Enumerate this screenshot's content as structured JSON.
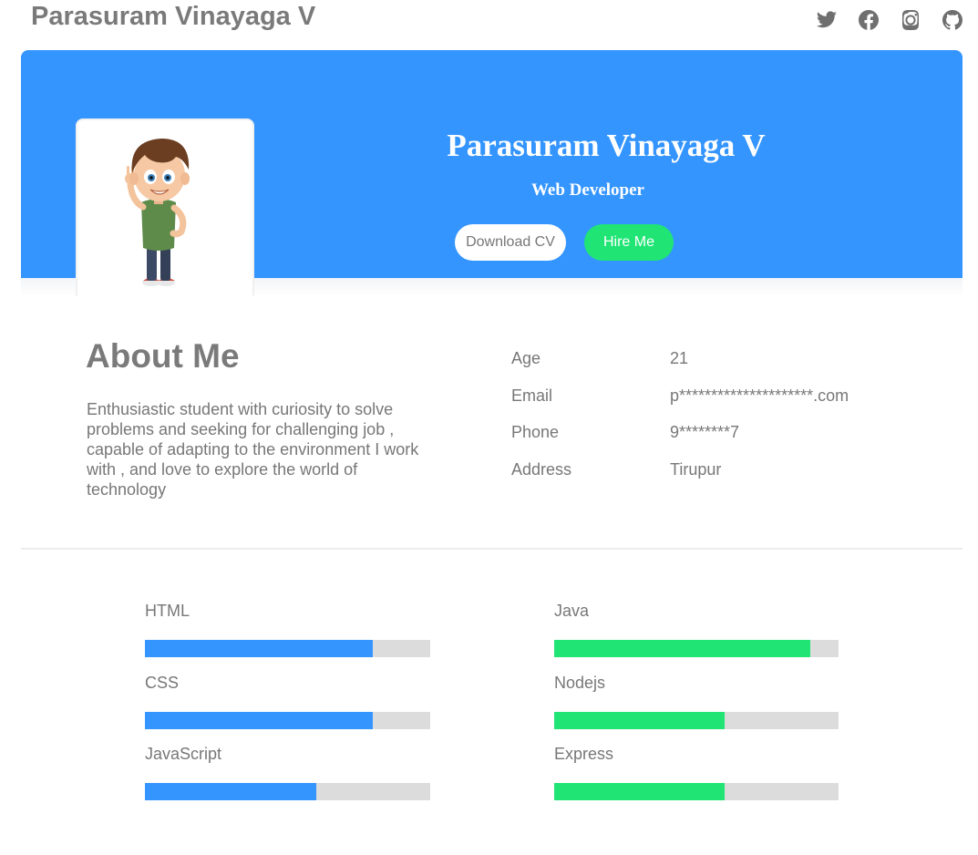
{
  "header": {
    "site_title": "Parasuram Vinayaga V",
    "social": [
      {
        "name": "twitter-icon"
      },
      {
        "name": "facebook-icon"
      },
      {
        "name": "instagram-icon"
      },
      {
        "name": "github-icon"
      }
    ]
  },
  "hero": {
    "name": "Parasuram Vinayaga V",
    "role": "Web Developer",
    "download_cv_label": "Download CV",
    "hire_me_label": "Hire Me",
    "avatar": "cartoon-boy-avatar"
  },
  "about": {
    "title": "About Me",
    "text": "Enthusiastic student with curiosity to solve problems and seeking for challenging job , capable of adapting to the environment I work with , and love to explore the world of technology",
    "details": [
      {
        "label": "Age",
        "value": "21"
      },
      {
        "label": "Email",
        "value": "p*********************.com"
      },
      {
        "label": "Phone",
        "value": "9********7"
      },
      {
        "label": "Address",
        "value": "Tirupur"
      }
    ]
  },
  "skills": {
    "left": [
      {
        "name": "HTML",
        "level": 0.8
      },
      {
        "name": "CSS",
        "level": 0.8
      },
      {
        "name": "JavaScript",
        "level": 0.6
      }
    ],
    "right": [
      {
        "name": "Java",
        "level": 0.9
      },
      {
        "name": "Nodejs",
        "level": 0.6
      },
      {
        "name": "Express",
        "level": 0.6
      }
    ]
  },
  "colors": {
    "primary": "#3495fe",
    "accent": "#20e575",
    "track": "#dcdcdc",
    "text": "#777777"
  }
}
